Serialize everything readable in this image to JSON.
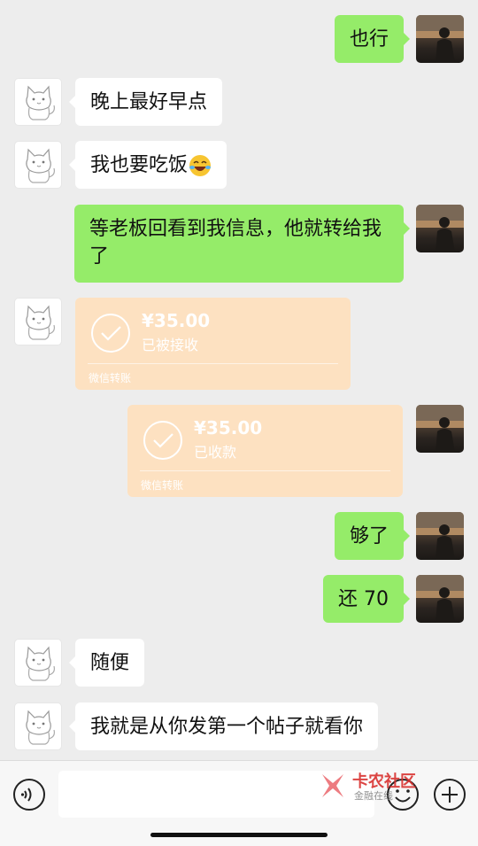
{
  "messages": [
    {
      "side": "right",
      "text": "也行"
    },
    {
      "side": "left",
      "text": "晚上最好早点"
    },
    {
      "side": "left",
      "text": "我也要吃饭",
      "emoji": "laughing-crying-emoji"
    },
    {
      "side": "right",
      "text": "等老板回看到我信息，他就转给我了"
    },
    {
      "side": "left",
      "type": "transfer",
      "amount": "¥35.00",
      "status": "已被接收",
      "source": "微信转账"
    },
    {
      "side": "right",
      "type": "transfer",
      "amount": "¥35.00",
      "status": "已收款",
      "source": "微信转账"
    },
    {
      "side": "right",
      "text": "够了"
    },
    {
      "side": "right",
      "text": "还 70"
    },
    {
      "side": "left",
      "text": "随便"
    },
    {
      "side": "left",
      "text": "我就是从你发第一个帖子就看你"
    }
  ],
  "input": {
    "value": "",
    "voice_icon": "voice-icon",
    "emoji_icon": "emoji-icon",
    "plus_icon": "plus-icon"
  },
  "watermark": {
    "title": "卡农社区",
    "subtitle": "金融在线"
  },
  "colors": {
    "background": "#ededed",
    "bubble_self": "#95ec69",
    "bubble_other": "#ffffff",
    "transfer": "#fde1c1"
  }
}
